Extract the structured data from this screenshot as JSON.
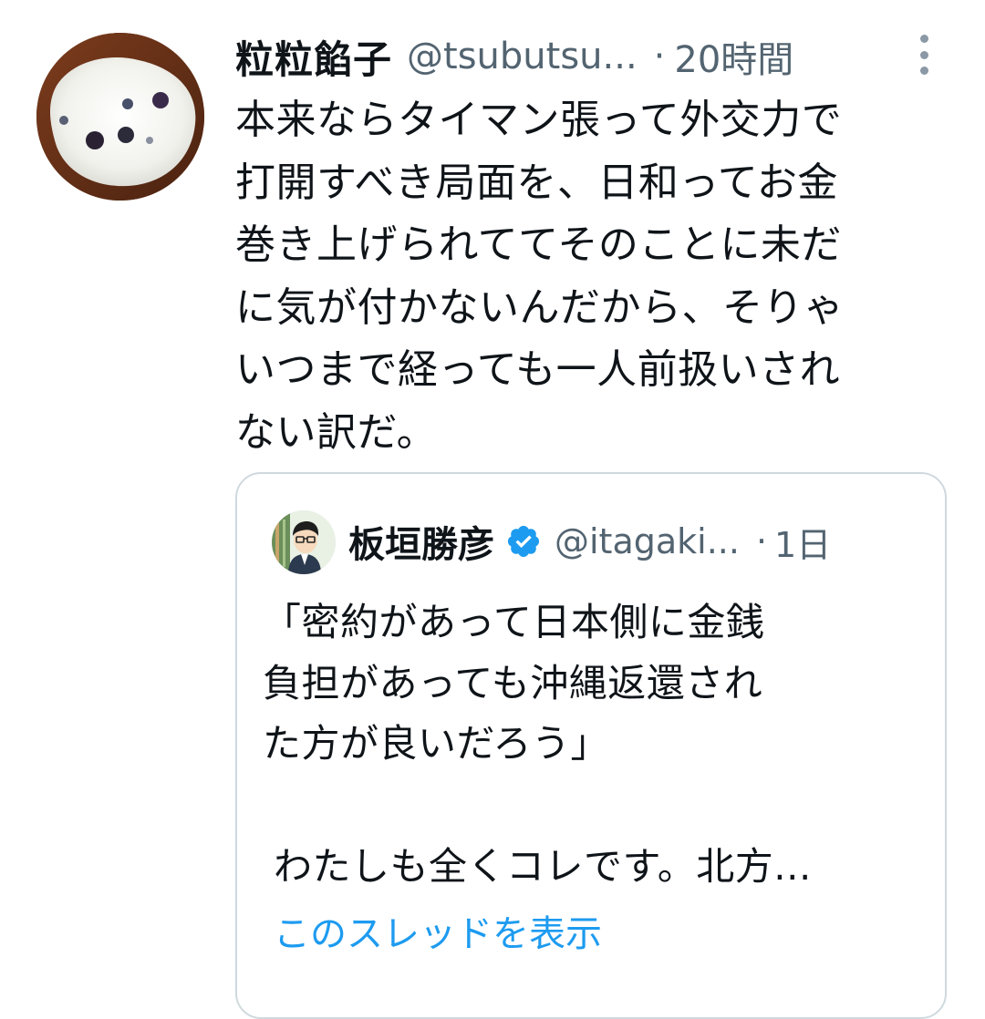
{
  "tweet": {
    "display_name": "粒粒餡子",
    "handle": "@tsubutsu...",
    "separator": "·",
    "time": "20時間",
    "avatar_icon": "user-avatar-icon",
    "more_icon": "more-vertical-icon",
    "text": "本来ならタイマン張って外交力で\n打開すべき局面を、日和ってお金\n巻き上げられててそのことに未だ\nに気が付かないんだから、そりゃ\nいつまで経っても一人前扱いされ\nない訳だ。"
  },
  "quoted": {
    "display_name": "板垣勝彦",
    "verified_icon": "verified-badge-icon",
    "handle": "@itagaki...",
    "separator": "·",
    "time": "1日",
    "text": "「密約があって日本側に金銭\n負担があっても沖縄返還され\nた方が良いだろう」",
    "text_continued": "わたしも全くコレです。北方...",
    "show_thread_label": "このスレッドを表示"
  },
  "colors": {
    "text_primary": "#0f1419",
    "text_secondary": "#536471",
    "link": "#1d9bf0",
    "border": "#cfd9de",
    "verified": "#1d9bf0"
  }
}
